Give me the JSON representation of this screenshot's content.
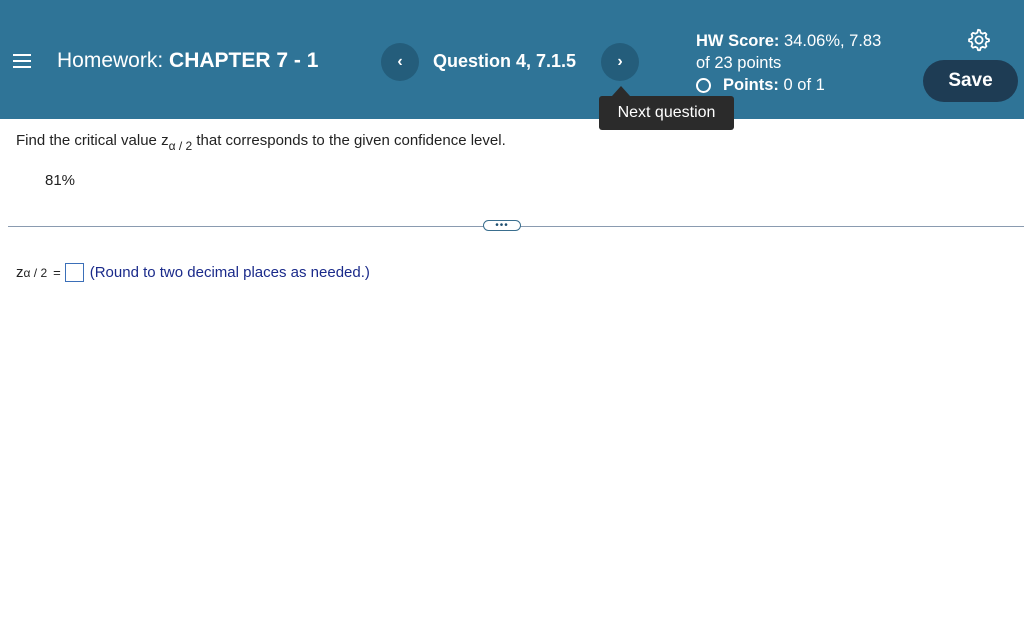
{
  "header": {
    "title_prefix": "Homework:",
    "title_main": "CHAPTER 7 - 1",
    "prev_glyph": "‹",
    "next_glyph": "›",
    "question_label": "Question 4, 7.1.5",
    "hw_score_label": "HW Score:",
    "hw_score_value": "34.06%, 7.83",
    "hw_score_line2": "of 23 points",
    "points_label": "Points:",
    "points_value": "0 of 1",
    "save_label": "Save",
    "tooltip": "Next question",
    "bg_color": "#2f7497"
  },
  "question": {
    "prompt_before": "Find the critical value z",
    "prompt_sub": "α / 2",
    "prompt_after": " that corresponds to the given confidence level.",
    "confidence_level": "81%",
    "more_glyph": "•••"
  },
  "answer": {
    "var_z": "z",
    "var_sub": "α / 2",
    "equals": "=",
    "input_value": "",
    "instruction": "(Round to two decimal places as needed.)"
  }
}
